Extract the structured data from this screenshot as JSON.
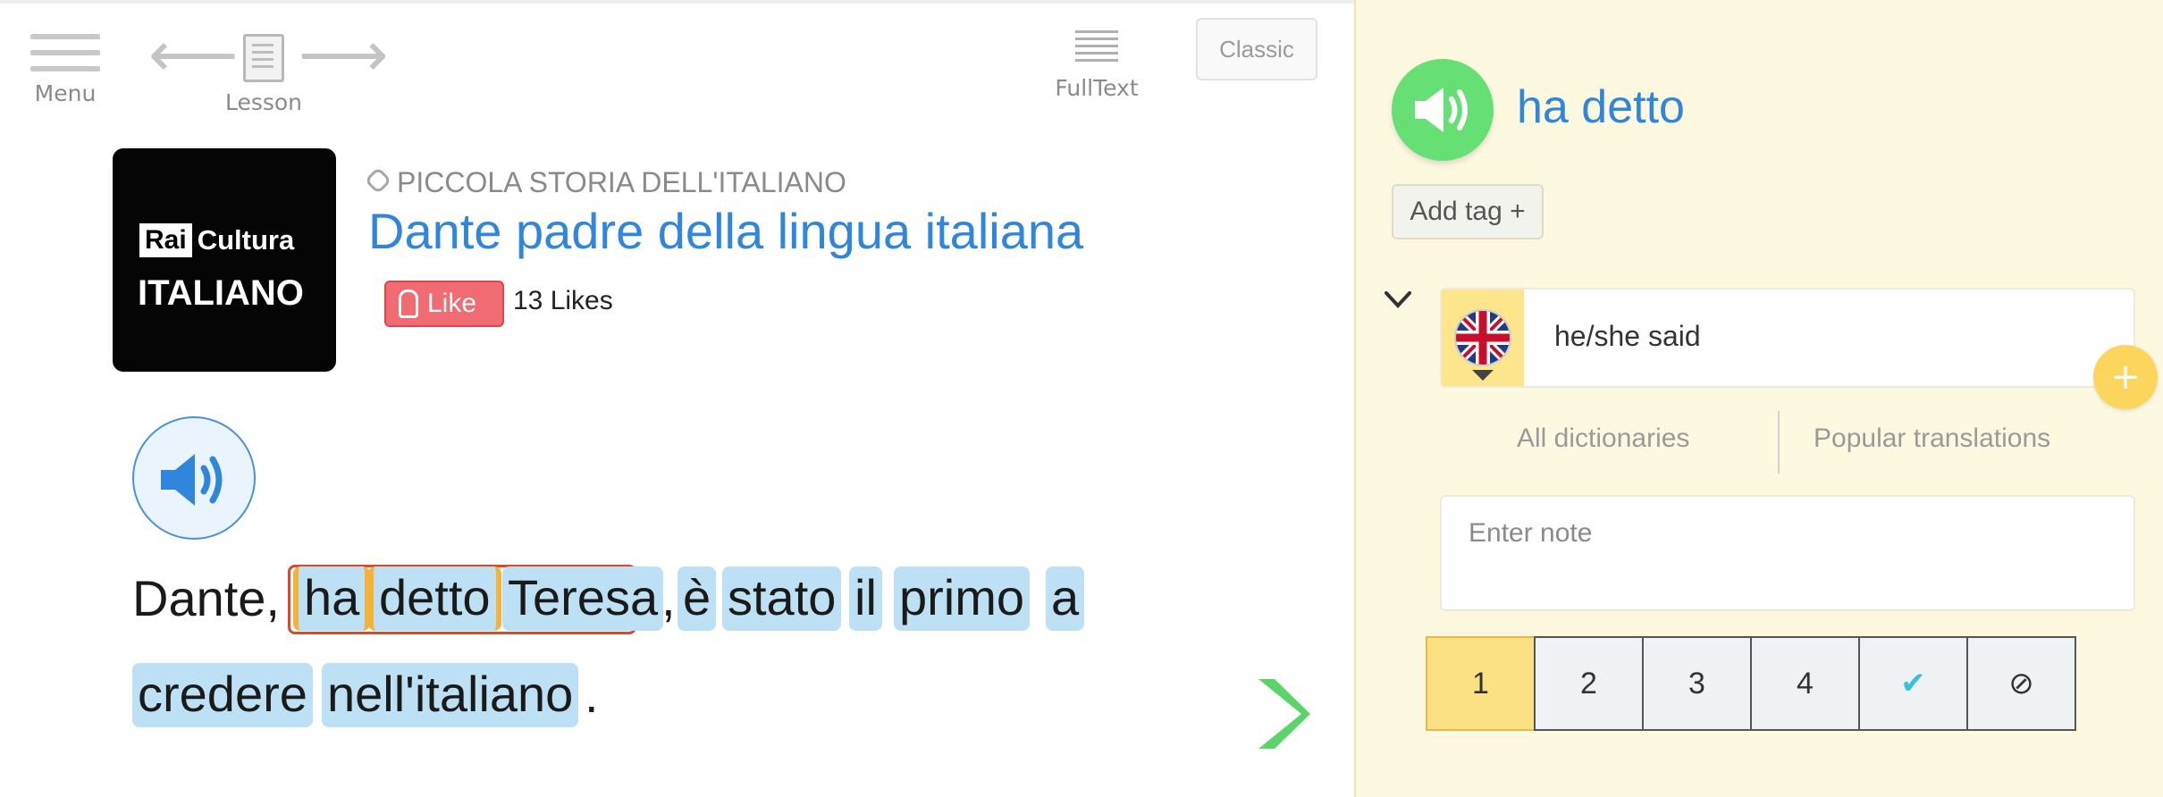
{
  "toolbar": {
    "menu_label": "Menu",
    "lesson_label": "Lesson",
    "fulltext_label": "FullText",
    "classic_label": "Classic"
  },
  "lesson": {
    "logo_rai": "Rai",
    "logo_cultura": "Cultura",
    "logo_italiano": "ITALIANO",
    "course": "PICCOLA STORIA DELL'ITALIANO",
    "title": "Dante padre della lingua italiana",
    "like_label": "Like",
    "likes_count": "13 Likes"
  },
  "sentence": {
    "line1": [
      "Dante,",
      "ha",
      "detto",
      "Teresa",
      ",",
      "è",
      "stato",
      "il",
      "primo",
      "a"
    ],
    "line2": [
      "credere",
      "nell'italiano",
      "."
    ]
  },
  "panel": {
    "word": "ha detto",
    "add_tag_label": "Add tag +",
    "translation": "he/she said",
    "plus_symbol": "+",
    "dict_all": "All dictionaries",
    "dict_popular": "Popular translations",
    "note_placeholder": "Enter note",
    "levels": [
      "1",
      "2",
      "3",
      "4",
      "✔",
      "⊘"
    ],
    "active_level": "1"
  },
  "colors": {
    "accent_blue": "#2f86dc",
    "word_highlight": "#bde0f4",
    "selection_border": "#d94a2b",
    "panel_bg": "#fdf9e1",
    "speak_green": "#66df74",
    "next_green": "#5bd46a",
    "level_active": "#fce084"
  }
}
